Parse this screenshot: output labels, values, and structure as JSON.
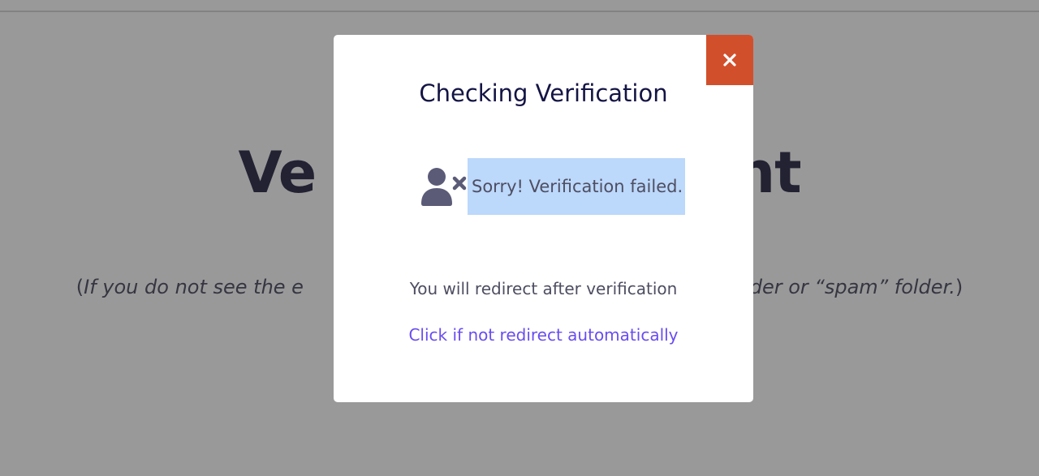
{
  "page": {
    "heading_left": "Ve",
    "heading_right": "nt",
    "note_open": "(",
    "note_left": "If you do not see the e",
    "note_right": "folder or “spam” folder.",
    "note_close": ")"
  },
  "modal": {
    "title": "Checking Verification",
    "close_icon": "close-icon",
    "status_icon": "user-times-icon",
    "status_text": "Sorry! Verification failed.",
    "redirect_text": "You will redirect after verification",
    "redirect_link": "Click if not redirect automatically"
  },
  "colors": {
    "close_button": "#d24f2c",
    "title": "#141445",
    "link": "#6a4cf0",
    "selection": "#bcd8fb"
  }
}
